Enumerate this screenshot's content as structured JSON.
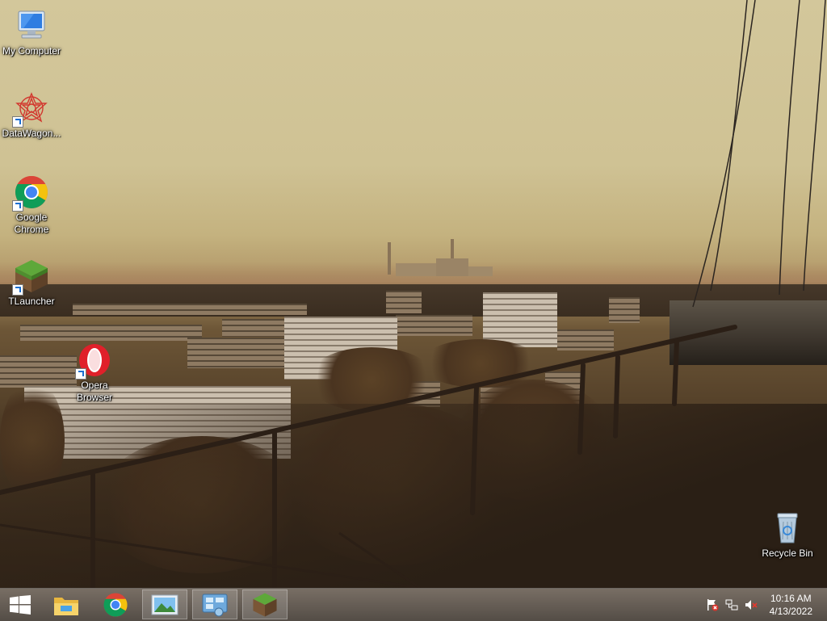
{
  "desktop": {
    "icons": [
      {
        "label": "My Computer"
      },
      {
        "label": "DataWagon..."
      },
      {
        "label": "Google\nChrome"
      },
      {
        "label": "TLauncher"
      },
      {
        "label": "Opera\nBrowser"
      },
      {
        "label": "Recycle Bin"
      }
    ]
  },
  "taskbar": {
    "buttons": [
      {
        "icon": "windows-start-icon"
      },
      {
        "icon": "file-explorer-icon"
      },
      {
        "icon": "chrome-icon"
      },
      {
        "icon": "photo-viewer-icon"
      },
      {
        "icon": "control-panel-icon"
      },
      {
        "icon": "tlauncher-icon"
      }
    ],
    "tray": {
      "icons": [
        "action-center-flag-icon",
        "network-icon",
        "volume-muted-icon"
      ],
      "time": "10:16 AM",
      "date": "4/13/2022"
    }
  },
  "colors": {
    "taskbar": "#4f453b",
    "label_text": "#ffffff",
    "chrome_red": "#db4437",
    "chrome_yellow": "#f4c20d",
    "chrome_green": "#0f9d58",
    "chrome_blue": "#4285f4",
    "opera_red": "#e0202a"
  }
}
